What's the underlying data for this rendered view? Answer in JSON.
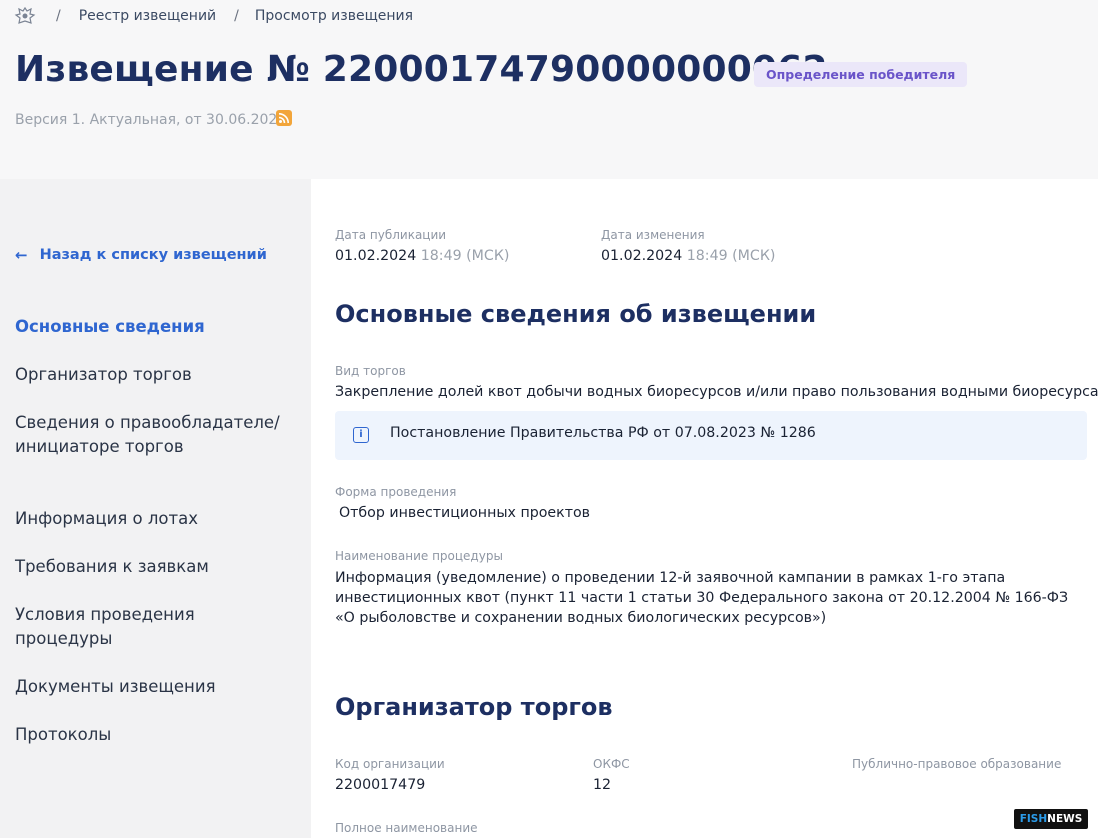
{
  "breadcrumbs": {
    "items": [
      "Реестр извещений",
      "Просмотр извещения"
    ],
    "separator": "/"
  },
  "header": {
    "title": "Извещение № 22000174790000000062",
    "status_badge": "Определение победителя",
    "version": "Версия 1. Актуальная, от 30.06.2024"
  },
  "sidebar": {
    "back_link": "Назад к списку извещений",
    "items": [
      {
        "label": "Основные сведения",
        "active": true
      },
      {
        "label": "Организатор торгов"
      },
      {
        "label": "Сведения о правообладателе/инициаторе торгов"
      },
      {
        "label": "Информация о лотах"
      },
      {
        "label": "Требования к заявкам"
      },
      {
        "label": "Условия проведения процедуры"
      },
      {
        "label": "Документы извещения"
      },
      {
        "label": "Протоколы"
      }
    ]
  },
  "dates": {
    "published_label": "Дата публикации",
    "published_date": "01.02.2024",
    "published_time": "18:49 (МСК)",
    "modified_label": "Дата изменения",
    "modified_date": "01.02.2024",
    "modified_time": "18:49 (МСК)"
  },
  "basic_info": {
    "heading": "Основные сведения об извещении",
    "type_label": "Вид торгов",
    "type_value": "Закрепление долей квот добычи водных биоресурсов и/или право пользования водными биоресурсами",
    "regulation": "Постановление Правительства РФ от 07.08.2023 № 1286",
    "form_label": "Форма проведения",
    "form_value": "Отбор инвестиционных проектов",
    "procedure_label": "Наименование процедуры",
    "procedure_value": "Информация (уведомление) о проведении 12-й заявочной кампании в рамках 1-го этапа инвестиционных квот (пункт 11 части 1 статьи 30 Федерального закона от 20.12.2004 № 166-ФЗ «О рыболовстве и сохранении водных биологических ресурсов»)"
  },
  "organizer": {
    "heading": "Организатор торгов",
    "code_label": "Код организации",
    "code_value": "2200017479",
    "okfs_label": "ОКФС",
    "okfs_value": "12",
    "public_entity_label": "Публично-правовое образование",
    "full_name_label": "Полное наименование"
  },
  "watermark": {
    "part1": "FISH",
    "part2": "NEWS"
  },
  "colors": {
    "accent": "#2f66d0",
    "title": "#1d2f62",
    "badge_bg": "#ebe7f9",
    "badge_text": "#6a54c9",
    "info_bg": "#eef4fd",
    "rss": "#f2a53a"
  }
}
